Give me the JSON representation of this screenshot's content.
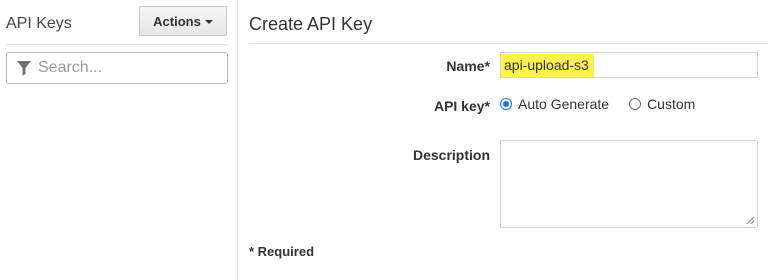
{
  "sidebar": {
    "title": "API Keys",
    "actions_label": "Actions",
    "search": {
      "placeholder": "Search...",
      "value": ""
    },
    "filter_icon": "filter-icon"
  },
  "main": {
    "title": "Create API Key",
    "form": {
      "name_label": "Name*",
      "name_value": "api-upload-s3",
      "name_highlight_color": "#fff14d",
      "apikey_label": "API key*",
      "apikey_options": [
        {
          "label": "Auto Generate",
          "selected": true
        },
        {
          "label": "Custom",
          "selected": false
        }
      ],
      "description_label": "Description",
      "description_value": ""
    },
    "required_note": "* Required"
  },
  "colors": {
    "radio_accent": "#1a73e8",
    "border": "#d5d5d5",
    "divider": "#e1e1e1"
  }
}
